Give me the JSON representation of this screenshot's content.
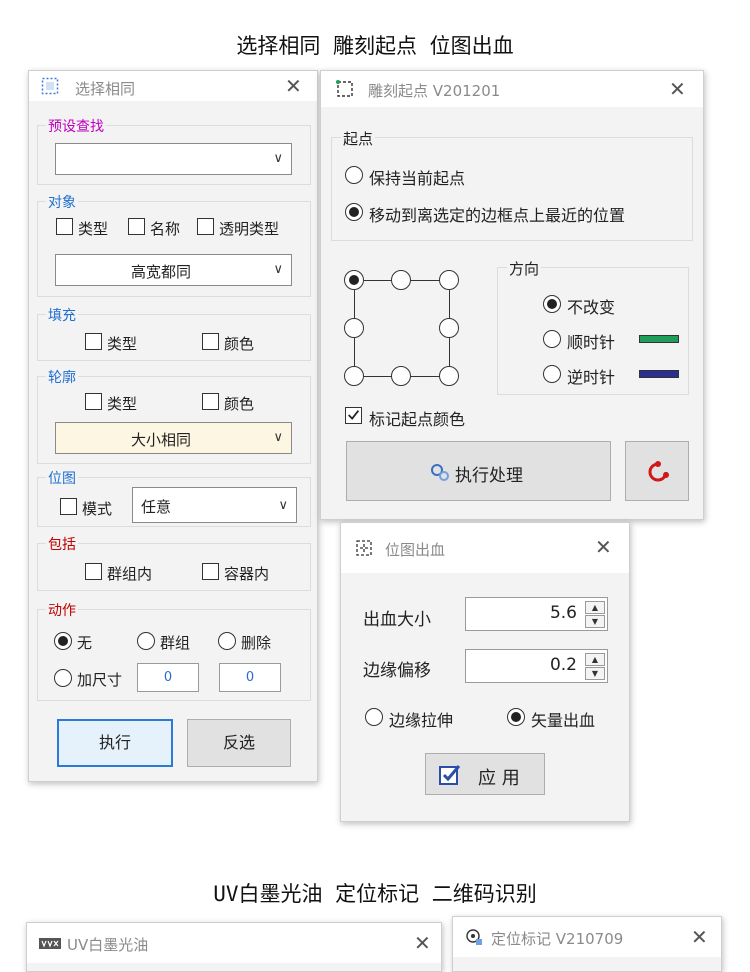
{
  "headings": {
    "top": "选择相同 雕刻起点 位图出血",
    "bottom": "UV白墨光油 定位标记 二维码识别"
  },
  "select_same": {
    "title": "选择相同",
    "preset": {
      "label": "预设查找",
      "value": ""
    },
    "object": {
      "label": "对象",
      "checks": [
        "类型",
        "名称",
        "透明类型"
      ],
      "combo": "高宽都同"
    },
    "fill": {
      "label": "填充",
      "checks": [
        "类型",
        "颜色"
      ]
    },
    "outline": {
      "label": "轮廓",
      "checks": [
        "类型",
        "颜色"
      ],
      "combo": "大小相同"
    },
    "bitmap": {
      "label": "位图",
      "check": "模式",
      "combo": "任意"
    },
    "include": {
      "label": "包括",
      "checks": [
        "群组内",
        "容器内"
      ]
    },
    "action": {
      "label": "动作",
      "radios": [
        "无",
        "群组",
        "删除"
      ],
      "resize": "加尺寸",
      "w": "0",
      "h": "0"
    },
    "buttons": {
      "execute": "执行",
      "invert": "反选"
    },
    "colors": {
      "preset_label": "#c000c0",
      "object_label": "#1f6fd0",
      "action_label": "#c00000"
    }
  },
  "engrave": {
    "title": "雕刻起点 V201201",
    "start": {
      "label": "起点",
      "opt1": "保持当前起点",
      "opt2": "移动到离选定的边框点上最近的位置"
    },
    "direction": {
      "label": "方向",
      "opt1": "不改变",
      "opt2": "顺时针",
      "opt3": "逆时针"
    },
    "mark_color": "标记起点颜色",
    "execute": "执行处理",
    "colors": {
      "clockwise": "#1e9e5a",
      "counter": "#2b2f8f"
    }
  },
  "bleed": {
    "title": "位图出血",
    "size_label": "出血大小",
    "size_value": "5.6",
    "offset_label": "边缘偏移",
    "offset_value": "0.2",
    "opt_stretch": "边缘拉伸",
    "opt_vector": "矢量出血",
    "apply": "应 用"
  },
  "uv": {
    "title": "UV白墨光油"
  },
  "locate": {
    "title": "定位标记 V210709"
  }
}
